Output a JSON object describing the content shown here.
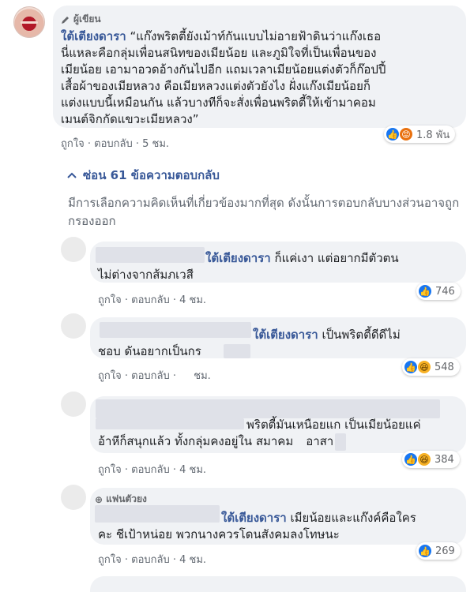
{
  "main_comment": {
    "badge": "ผู้เขียน",
    "author": "ใต้เตียงดารา",
    "lines": [
      "“แก๊งพริตตี้ยังเม้าท์กันแบบไม่อายฟ้าดินว่าแก๊งเธอ",
      "นี่แหละคือกลุ่มเพื่อนสนิทของเมียน้อย และภูมิใจที่เป็นเพื่อนของ",
      "เมียน้อย เอามาอวดอ้างกันไปอีก แถมเวลาเมียน้อยแต่งตัวก็ก๊อปปี้",
      "เสื้อผ้าของเมียหลวง คือเมียหลวงแต่งตัวยังไง ฝั่งแก๊งเมียน้อยก็",
      "แต่งแบบนี้เหมือนกัน แล้วบางทีก็จะสั่งเพื่อนพริตตี้ให้เข้ามาคอม",
      "เมนต์จิกกัดแขวะเมียหลวง”"
    ],
    "like": "ถูกใจ",
    "reply": "ตอบกลับ",
    "time": "5 ชม.",
    "reactions": "1.8 พัน"
  },
  "replies_toggle": "ซ่อน 61 ข้อความตอบกลับ",
  "filter_note": "มีการเลือกความคิดเห็นที่เกี่ยวข้องมากที่สุด ดังนั้นการตอบกลับบางส่วนอาจถูกกรองออก",
  "replies": [
    {
      "mention": "ใต้เตียงดารา",
      "line1": "ก็แค่เงา แต่อยากมีตัวตน",
      "line2": "ไม่ต่างจากส้มภเวสี",
      "like": "ถูกใจ",
      "reply": "ตอบกลับ",
      "time": "4 ชม.",
      "reactions": "746"
    },
    {
      "mention": "ใต้เตียงดารา",
      "line1": "เป็นพริตตี้ดีดีไม่",
      "line2": "ชอบ ดันอยากเป็นกร",
      "like": "ถูกใจ",
      "reply": "ตอบกลับ",
      "time": "ชม.",
      "reactions": "548"
    },
    {
      "line1": "พริตตี้มันเหนือยแก เป็นเมียน้อยแค่",
      "line2a": "อ้าหีก็สนุกแล้ว ทั้งกลุ่มคงอยู่ใน สมาคม",
      "line2b": "อาสา",
      "like": "ถูกใจ",
      "reply": "ตอบกลับ",
      "time": "4 ชม.",
      "reactions": "384"
    },
    {
      "badge": "แฟนตัวยง",
      "mention": "ใต้เตียงดารา",
      "line1": "เมียน้อยและแก๊งค์คือใคร",
      "line2": "คะ ชีเป้าหน่อย พวกนางควรโดนสังคมลงโทษนะ",
      "like": "ถูกใจ",
      "reply": "ตอบกลับ",
      "time": "4 ชม.",
      "reactions": "269"
    }
  ],
  "colors": {
    "link": "#385898",
    "bubble": "#f0f2f5",
    "like": "#1877f2"
  }
}
